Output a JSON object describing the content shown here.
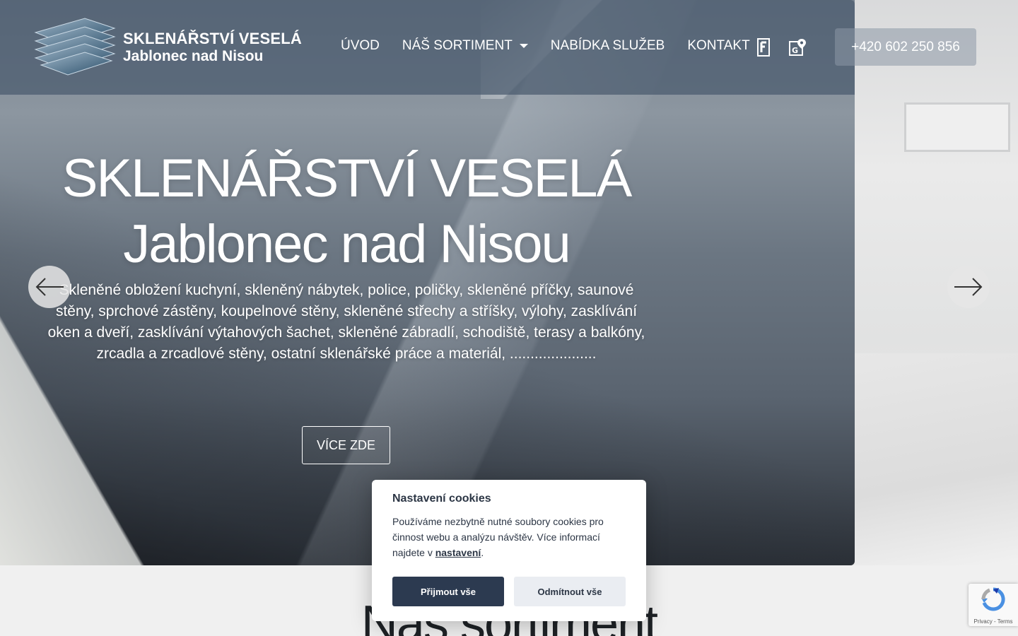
{
  "header": {
    "brand_line1": "SKLENÁŘSTVÍ VESELÁ",
    "brand_line2": "Jablonec nad Nisou",
    "nav": [
      {
        "label": "ÚVOD"
      },
      {
        "label": "NÁŠ SORTIMENT"
      },
      {
        "label": "NABÍDKA SLUŽEB"
      },
      {
        "label": "KONTAKT"
      }
    ],
    "phone": "+420 602 250 856"
  },
  "hero": {
    "title_line1": "SKLENÁŘSTVÍ VESELÁ",
    "title_line2": "Jablonec nad Nisou",
    "subtitle": "Skleněné obložení kuchyní, skleněný nábytek, police, poličky, skleněné příčky, saunové stěny, sprchové zástěny, koupelnové stěny, skleněné střechy a stříšky, výlohy, zasklívání oken a dveří, zasklívání výtahových šachet, skleněné zábradlí, schodiště, terasy a balkóny, zrcadla a zrcadlové stěny, ostatní sklenářské práce a materiál, .....................",
    "button": "VÍCE ZDE"
  },
  "section": {
    "title": "Náš sortiment"
  },
  "cookies": {
    "title": "Nastavení cookies",
    "text": "Používáme nezbytně nutné soubory cookies pro činnost webu a analýzu návštěv. Více informací najdete v ",
    "link": "nastavení",
    "text_end": ".",
    "accept": "Přijmout vše",
    "reject": "Odmítnout vše"
  },
  "recaptcha": {
    "caption": "Privacy - Terms"
  },
  "icons": {
    "facebook": "facebook-icon",
    "maps": "google-maps-icon",
    "prev": "arrow-left-icon",
    "next": "arrow-right-icon"
  },
  "colors": {
    "header_bg": "#4a5a6e",
    "accept_btn": "#2c3a50",
    "reject_btn": "#eaedf2",
    "text_dark": "#2c3645"
  }
}
